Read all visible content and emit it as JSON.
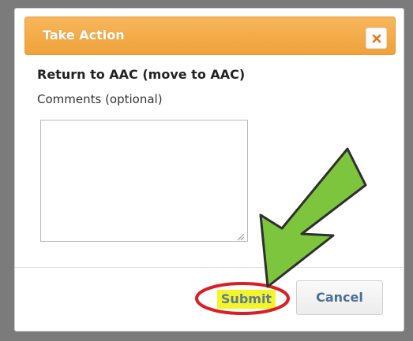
{
  "dialog": {
    "title": "Take Action",
    "close_icon": "close-icon",
    "action_text": "Return to AAC (move to AAC)",
    "comments_label": "Comments (optional)",
    "comments_value": "",
    "submit_label": "Submit",
    "cancel_label": "Cancel"
  },
  "colors": {
    "title_bar": "#f0a440",
    "submit_highlight": "#f3f52a",
    "annotation_ring": "#d81f26",
    "annotation_arrow": "#7dc53c"
  },
  "annotations": {
    "arrow_icon": "green-arrow-icon",
    "ring_icon": "red-ellipse-icon"
  }
}
